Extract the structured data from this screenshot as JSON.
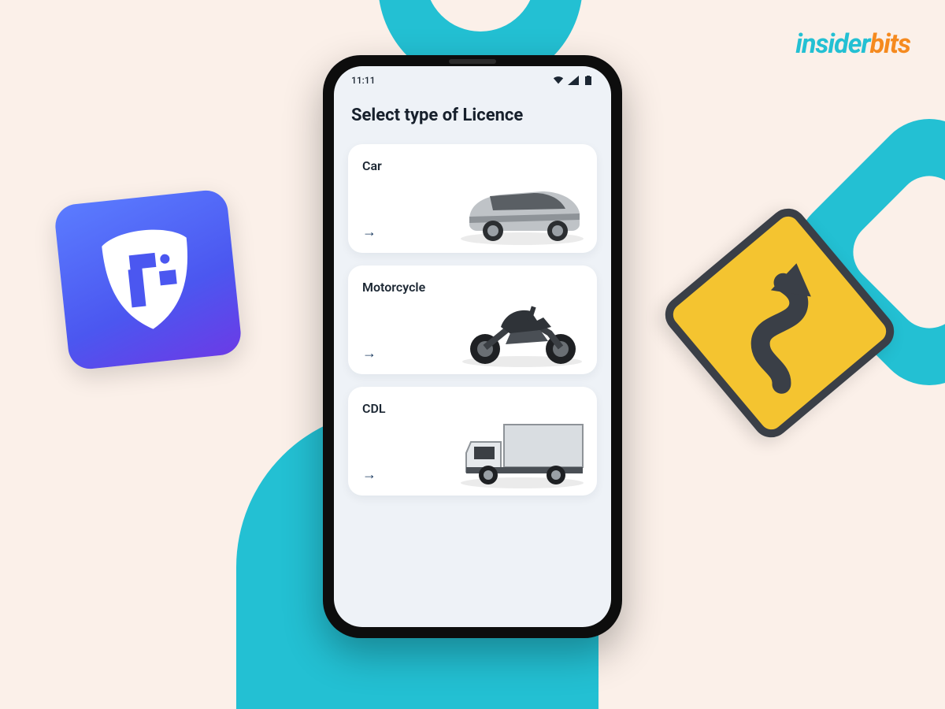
{
  "brand": {
    "part1": "insider",
    "part2": "bits"
  },
  "status": {
    "time": "11:11"
  },
  "screen": {
    "title": "Select type of Licence",
    "cards": [
      {
        "label": "Car",
        "icon": "car"
      },
      {
        "label": "Motorcycle",
        "icon": "motorcycle"
      },
      {
        "label": "CDL",
        "icon": "truck"
      }
    ],
    "arrow_glyph": "→"
  },
  "left_icon_name": "parivahan-app-icon",
  "right_sign_name": "winding-road-sign"
}
